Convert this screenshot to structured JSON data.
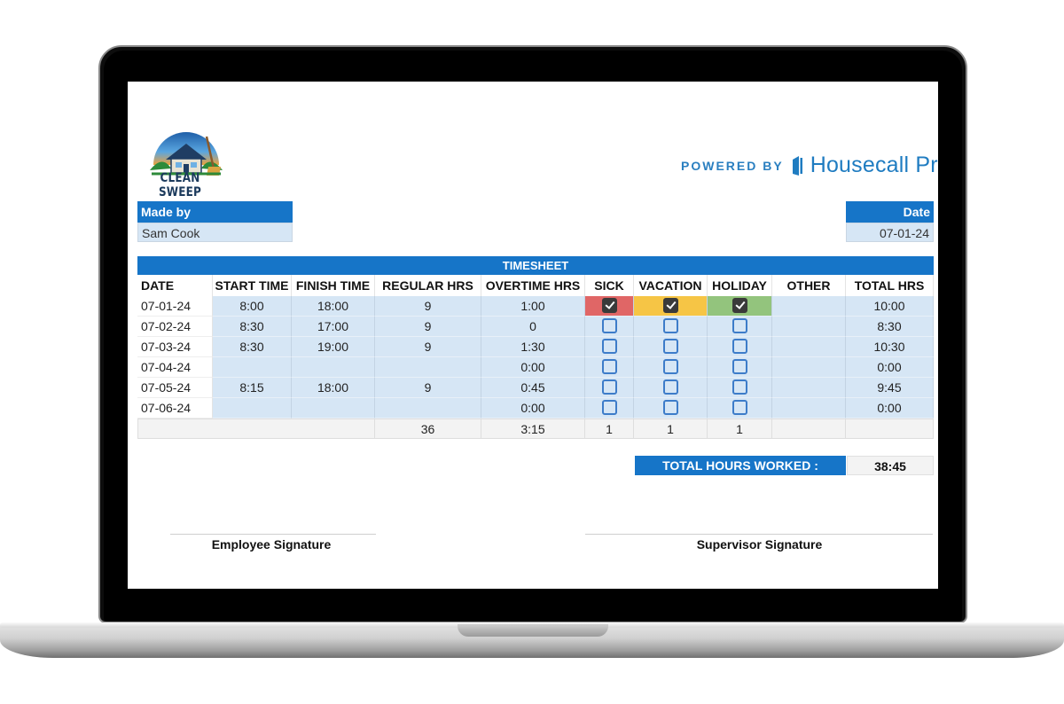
{
  "brand": {
    "logo_text": "CLEAN SWEEP",
    "powered_by": "POWERED BY",
    "partner": "Housecall Pro",
    "accent_color": "#1675c8"
  },
  "made_by": {
    "label": "Made by",
    "value": "Sam Cook"
  },
  "date_box": {
    "label": "Date",
    "value": "07-01-24"
  },
  "timesheet": {
    "title": "TIMESHEET",
    "columns": [
      "DATE",
      "START TIME",
      "FINISH TIME",
      "REGULAR HRS",
      "OVERTIME HRS",
      "SICK",
      "VACATION",
      "HOLIDAY",
      "OTHER",
      "TOTAL HRS"
    ],
    "rows": [
      {
        "date": "07-01-24",
        "start": "8:00",
        "finish": "18:00",
        "regular": "9",
        "overtime": "1:00",
        "sick": true,
        "vacation": true,
        "holiday": true,
        "other": "",
        "total": "10:00"
      },
      {
        "date": "07-02-24",
        "start": "8:30",
        "finish": "17:00",
        "regular": "9",
        "overtime": "0",
        "sick": false,
        "vacation": false,
        "holiday": false,
        "other": "",
        "total": "8:30"
      },
      {
        "date": "07-03-24",
        "start": "8:30",
        "finish": "19:00",
        "regular": "9",
        "overtime": "1:30",
        "sick": false,
        "vacation": false,
        "holiday": false,
        "other": "",
        "total": "10:30"
      },
      {
        "date": "07-04-24",
        "start": "",
        "finish": "",
        "regular": "",
        "overtime": "0:00",
        "sick": false,
        "vacation": false,
        "holiday": false,
        "other": "",
        "total": "0:00"
      },
      {
        "date": "07-05-24",
        "start": "8:15",
        "finish": "18:00",
        "regular": "9",
        "overtime": "0:45",
        "sick": false,
        "vacation": false,
        "holiday": false,
        "other": "",
        "total": "9:45"
      },
      {
        "date": "07-06-24",
        "start": "",
        "finish": "",
        "regular": "",
        "overtime": "0:00",
        "sick": false,
        "vacation": false,
        "holiday": false,
        "other": "",
        "total": "0:00"
      }
    ],
    "totals": {
      "regular": "36",
      "overtime": "3:15",
      "sick": "1",
      "vacation": "1",
      "holiday": "1"
    }
  },
  "total_hours": {
    "label": "TOTAL HOURS WORKED :",
    "value": "38:45"
  },
  "signatures": {
    "employee": "Employee Signature",
    "supervisor": "Supervisor Signature"
  }
}
